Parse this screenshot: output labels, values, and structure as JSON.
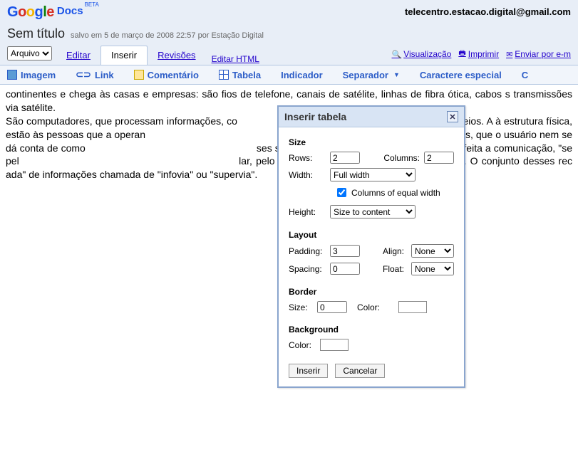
{
  "brand": {
    "google": "Google",
    "docs": "Docs",
    "beta": "BETA"
  },
  "user_email": "telecentro.estacao.digital@gmail.com",
  "doc_title": "Sem título",
  "save_info": "salvo em 5 de março de 2008 22:57 por Estação Digital",
  "file_menu": {
    "label": "Arquivo",
    "caret": "▾"
  },
  "tabs": {
    "edit": "Editar",
    "insert": "Inserir",
    "revisions": "Revisões",
    "edit_html": "Editar HTML"
  },
  "right_links": {
    "preview": "Visualização",
    "print": "Imprimir",
    "email": "Enviar por e-m"
  },
  "toolbar": {
    "image": "Imagem",
    "link": "Link",
    "comment": "Comentário",
    "table": "Tabela",
    "bookmark": "Indicador",
    "separator": "Separador",
    "special": "Caractere especial",
    "c": "C"
  },
  "document_text": "continentes e chega às casas e empresas: são fios de telefone, canais de satélite, linhas de fibra ótica, cabos s transmissões via satélite.\nSão computadores, que processam informações, co                                                     s os diversos meios. A à estrutura física, estão às pessoas que a operan                                                               ade de transmissão e oferecidos, que o usuário nem se dá conta de como                                                           ses serviços, e a maio menor idéia de como é feita a comunicação, \"se pel                                                           lar, pelo canal de um s cabo no fundo do oceano. O conjunto desses rec                                                        ada\" de informações chamada de \"infovia\" ou \"supervia\".",
  "dialog": {
    "title": "Inserir tabela",
    "size": {
      "heading": "Size",
      "rows_label": "Rows:",
      "rows_value": "2",
      "cols_label": "Columns:",
      "cols_value": "2",
      "width_label": "Width:",
      "width_value": "Full width",
      "equal_cols": "Columns of equal width",
      "equal_cols_checked": true,
      "height_label": "Height:",
      "height_value": "Size to content"
    },
    "layout": {
      "heading": "Layout",
      "padding_label": "Padding:",
      "padding_value": "3",
      "align_label": "Align:",
      "align_value": "None",
      "spacing_label": "Spacing:",
      "spacing_value": "0",
      "float_label": "Float:",
      "float_value": "None"
    },
    "border": {
      "heading": "Border",
      "size_label": "Size:",
      "size_value": "0",
      "color_label": "Color:"
    },
    "background": {
      "heading": "Background",
      "color_label": "Color:"
    },
    "buttons": {
      "insert": "Inserir",
      "cancel": "Cancelar"
    }
  }
}
